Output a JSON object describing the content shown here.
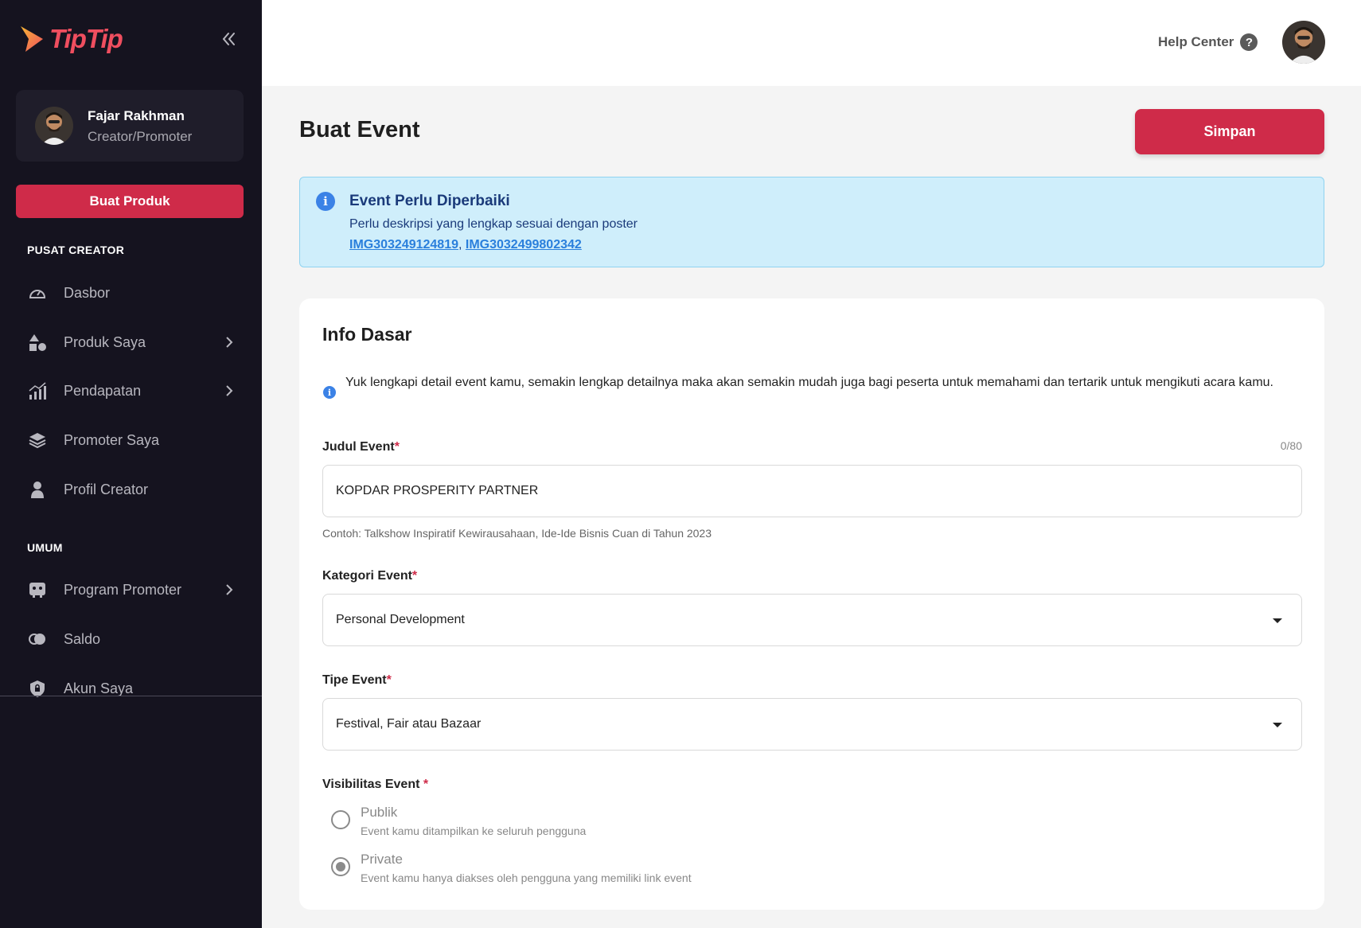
{
  "brand": {
    "name": "TipTip",
    "accent": "#cf2b49",
    "logo_color": "#ef4e5f"
  },
  "sidebar": {
    "profile": {
      "name": "Fajar Rakhman",
      "role": "Creator/Promoter"
    },
    "create_button": "Buat Produk",
    "sections": [
      {
        "label": "PUSAT CREATOR",
        "items": [
          {
            "label": "Dasbor",
            "icon": "dashboard-gauge-icon"
          },
          {
            "label": "Produk Saya",
            "icon": "shapes-icon",
            "has_submenu": true
          },
          {
            "label": "Pendapatan",
            "icon": "bar-chart-icon",
            "has_submenu": true
          },
          {
            "label": "Promoter Saya",
            "icon": "layers-icon"
          },
          {
            "label": "Profil Creator",
            "icon": "person-icon"
          }
        ]
      },
      {
        "label": "UMUM",
        "items": [
          {
            "label": "Program Promoter",
            "icon": "promoter-icon",
            "has_submenu": true
          },
          {
            "label": "Saldo",
            "icon": "coins-icon"
          },
          {
            "label": "Akun Saya",
            "icon": "lock-icon"
          }
        ]
      }
    ]
  },
  "topbar": {
    "help_label": "Help Center"
  },
  "page": {
    "title": "Buat Event",
    "save_label": "Simpan"
  },
  "alert": {
    "title": "Event Perlu Diperbaiki",
    "description": "Perlu deskripsi yang lengkap sesuai dengan poster",
    "links": [
      "IMG303249124819",
      "IMG3032499802342"
    ],
    "separator": ", "
  },
  "form": {
    "section_title": "Info Dasar",
    "info_text": "Yuk lengkapi detail event kamu, semakin lengkap detailnya maka akan semakin mudah juga bagi peserta untuk memahami dan tertarik untuk mengikuti acara kamu.",
    "title_field": {
      "label": "Judul Event",
      "required_mark": "*",
      "counter": "0/80",
      "value": "KOPDAR PROSPERITY PARTNER",
      "hint": "Contoh: Talkshow Inspiratif Kewirausahaan, Ide-Ide Bisnis Cuan di Tahun 2023"
    },
    "category_field": {
      "label": "Kategori Event",
      "required_mark": "*",
      "value": "Personal Development"
    },
    "type_field": {
      "label": "Tipe Event",
      "required_mark": "*",
      "value": "Festival, Fair atau Bazaar"
    },
    "visibility_field": {
      "label": "Visibilitas Event ",
      "required_mark": "*",
      "options": [
        {
          "label": "Publik",
          "description": "Event kamu ditampilkan ke seluruh pengguna",
          "selected": false
        },
        {
          "label": "Private",
          "description": "Event kamu hanya diakses oleh pengguna yang memiliki link event",
          "selected": true
        }
      ]
    }
  }
}
